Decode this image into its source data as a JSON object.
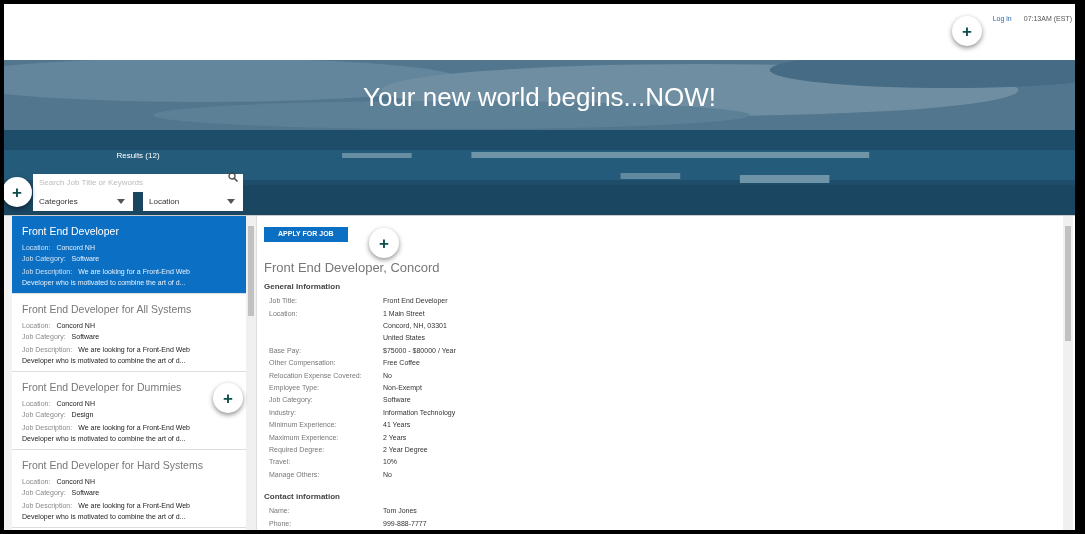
{
  "header": {
    "login": "Log in",
    "time": "07:13AM (EST)"
  },
  "hero": {
    "title": "Your new world begins...NOW!"
  },
  "search": {
    "results": "Results (12)",
    "placeholder": "Search Job Title or Keywords",
    "filters": [
      "Categories",
      "Location"
    ]
  },
  "listings": [
    {
      "title": "Front End Developer",
      "location_label": "Location:",
      "location": "Concord NH",
      "category_label": "Job Category:",
      "category": "Software",
      "description_label": "Job Description:",
      "description": "We are looking for a Front-End Web Developer who is motivated to combine the art of d...",
      "selected": true
    },
    {
      "title": "Front End Developer for All Systems",
      "location_label": "Location:",
      "location": "Concord NH",
      "category_label": "Job Category:",
      "category": "Software",
      "description_label": "Job Description:",
      "description": "We are looking for a Front-End Web Developer who is motivated to combine the art of d...",
      "selected": false
    },
    {
      "title": "Front End Developer for Dummies",
      "location_label": "Location:",
      "location": "Concord NH",
      "category_label": "Job Category:",
      "category": "Design",
      "description_label": "Job Description:",
      "description": "We are looking for a Front-End Web Developer who is motivated to combine the art of d...",
      "selected": false
    },
    {
      "title": "Front End Developer for Hard Systems",
      "location_label": "Location:",
      "location": "Concord NH",
      "category_label": "Job Category:",
      "category": "Software",
      "description_label": "Job Description:",
      "description": "We are looking for a Front-End Web Developer who is motivated to combine the art of d...",
      "selected": false
    }
  ],
  "detail": {
    "apply_button": "APPLY FOR JOB",
    "title": "Front End Developer, Concord",
    "sections": [
      {
        "heading": "General Information",
        "rows": [
          {
            "label": "Job Title:",
            "lines": [
              "Front End Developer"
            ]
          },
          {
            "label": "Location:",
            "lines": [
              "1 Main Street",
              "Concord, NH, 03301",
              "United States"
            ]
          },
          {
            "label": "Base Pay:",
            "lines": [
              "$75000 - $80000 / Year"
            ]
          },
          {
            "label": "Other Compensation:",
            "lines": [
              "Free Coffee"
            ]
          },
          {
            "label": "Relocation Expense Covered:",
            "lines": [
              "No"
            ]
          },
          {
            "label": "Employee Type:",
            "lines": [
              "Non-Exempt"
            ]
          },
          {
            "label": "Job Category:",
            "lines": [
              "Software"
            ]
          },
          {
            "label": "Industry:",
            "lines": [
              "Information Technology"
            ]
          },
          {
            "label": "Minimum Experience:",
            "lines": [
              "41 Years"
            ]
          },
          {
            "label": "Maximum Experience:",
            "lines": [
              "2 Years"
            ]
          },
          {
            "label": "Required Degree:",
            "lines": [
              "2 Year Degree"
            ]
          },
          {
            "label": "Travel:",
            "lines": [
              "10%"
            ]
          },
          {
            "label": "Manage Others:",
            "lines": [
              "No"
            ]
          }
        ]
      },
      {
        "heading": "Contact information",
        "rows": [
          {
            "label": "Name:",
            "lines": [
              "Tom Jones"
            ]
          },
          {
            "label": "Phone:",
            "lines": [
              "999-888-7777"
            ]
          }
        ]
      }
    ]
  },
  "hotspots": [
    {
      "label": "+"
    },
    {
      "label": "+"
    },
    {
      "label": "+"
    },
    {
      "label": "+"
    }
  ]
}
